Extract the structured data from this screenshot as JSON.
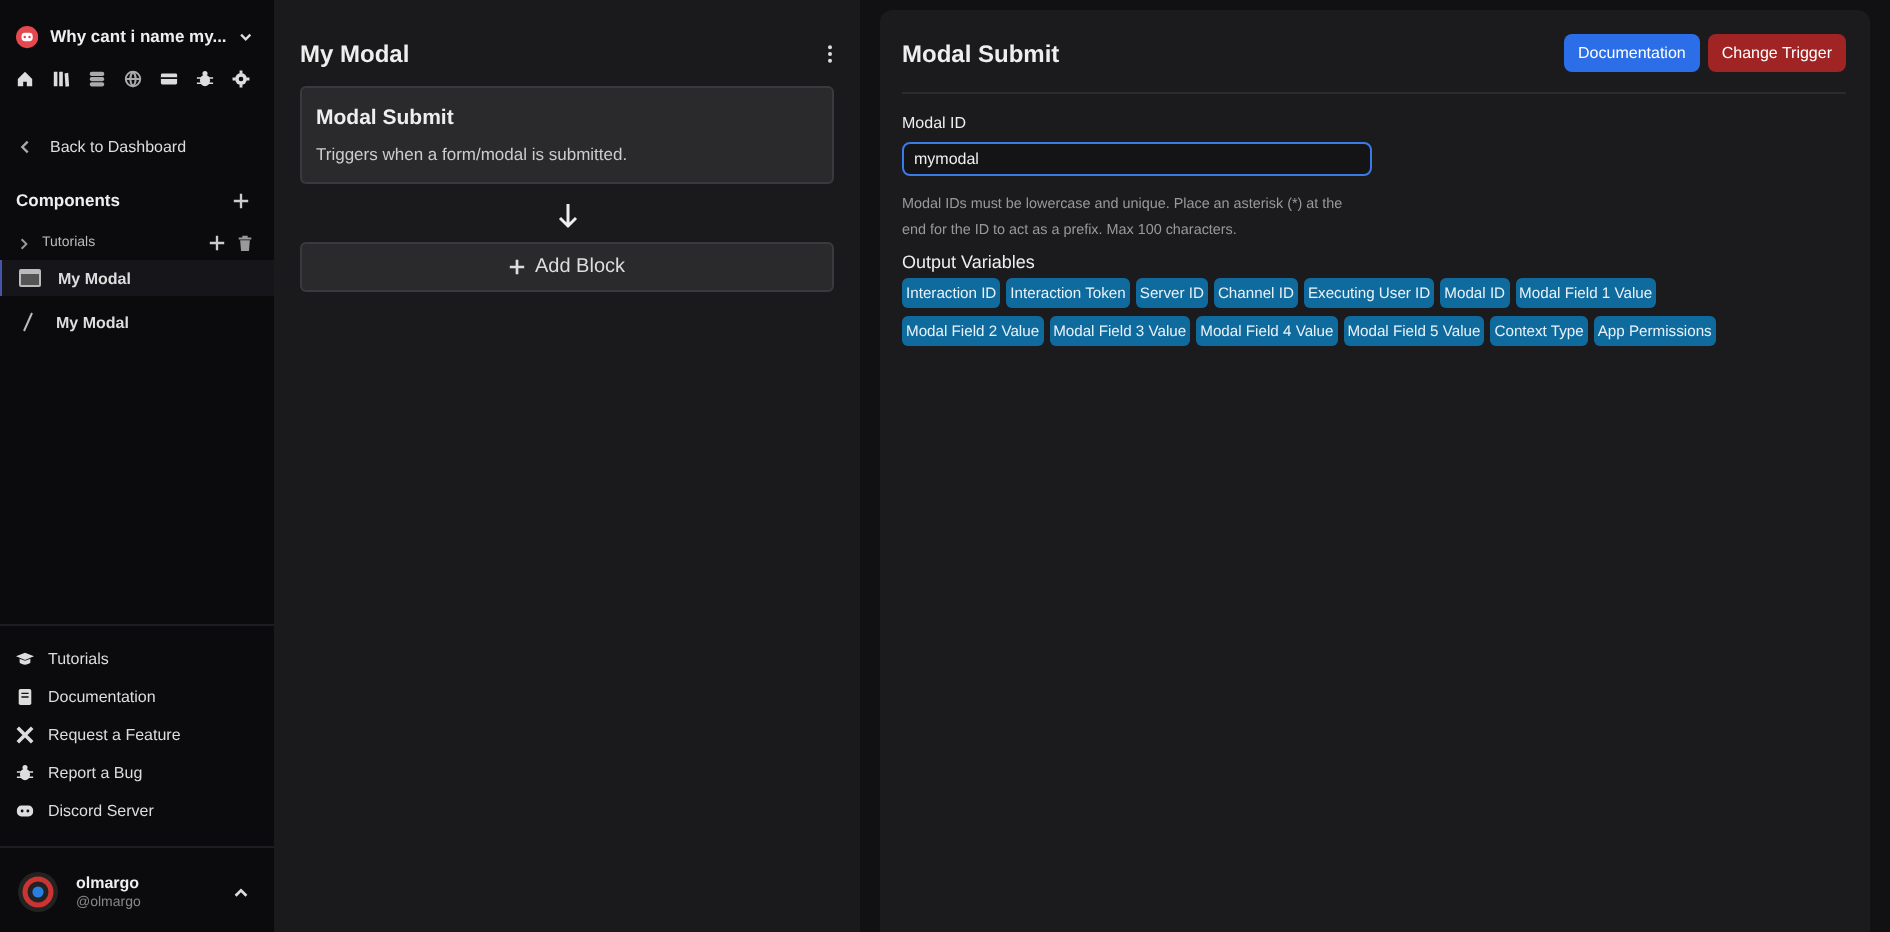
{
  "sidebar": {
    "app_name": "Why cant i name my...",
    "back_link": "Back to Dashboard",
    "components_heading": "Components",
    "folders": [
      {
        "label": "Tutorials",
        "expanded": false
      }
    ],
    "items": [
      {
        "label": "My Modal",
        "kind": "module",
        "selected": true
      },
      {
        "label": "My Modal",
        "kind": "command",
        "selected": false
      }
    ],
    "footer_links": [
      {
        "label": "Tutorials",
        "kind": "cap"
      },
      {
        "label": "Documentation",
        "kind": "book"
      },
      {
        "label": "Request a Feature",
        "kind": "tools"
      },
      {
        "label": "Report a Bug",
        "kind": "bug"
      },
      {
        "label": "Discord Server",
        "kind": "discord"
      }
    ],
    "user": {
      "name": "olmargo",
      "handle": "@olmargo"
    }
  },
  "flow": {
    "title": "My Modal",
    "trigger_block": {
      "title": "Modal Submit",
      "description": "Triggers when a form/modal is submitted."
    },
    "add_block": "Add Block"
  },
  "details": {
    "title": "Modal Submit",
    "buttons": [
      {
        "label": "Documentation",
        "kind": "primary"
      },
      {
        "label": "Change Trigger",
        "kind": "danger"
      }
    ],
    "field": {
      "label": "Modal ID",
      "value": "mymodal",
      "help": "Modal IDs must be lowercase and unique. Place an asterisk (*) at the end for the ID to act as a prefix. Max 100 characters."
    },
    "variables_heading": "Output Variables",
    "variables": [
      "Interaction ID",
      "Interaction Token",
      "Server ID",
      "Channel ID",
      "Executing User ID",
      "Modal ID",
      "Modal Field 1 Value",
      "Modal Field 2 Value",
      "Modal Field 3 Value",
      "Modal Field 4 Value",
      "Modal Field 5 Value",
      "Context Type",
      "App Permissions"
    ]
  }
}
